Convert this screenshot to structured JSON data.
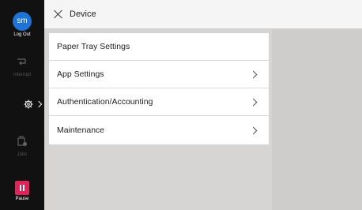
{
  "sidebar": {
    "avatar_initials": "sm",
    "logout_label": "Log Out",
    "interrupt_label": "Interrupt",
    "jobs_label": "Jobs",
    "pause_label": "Pause"
  },
  "header": {
    "title": "Device"
  },
  "menu": {
    "items": [
      {
        "label": "Paper Tray Settings"
      },
      {
        "label": "App Settings"
      },
      {
        "label": "Authentication/Accounting"
      },
      {
        "label": "Maintenance"
      }
    ]
  },
  "colors": {
    "accent": "#1f72d6",
    "pause": "#e0245a"
  }
}
